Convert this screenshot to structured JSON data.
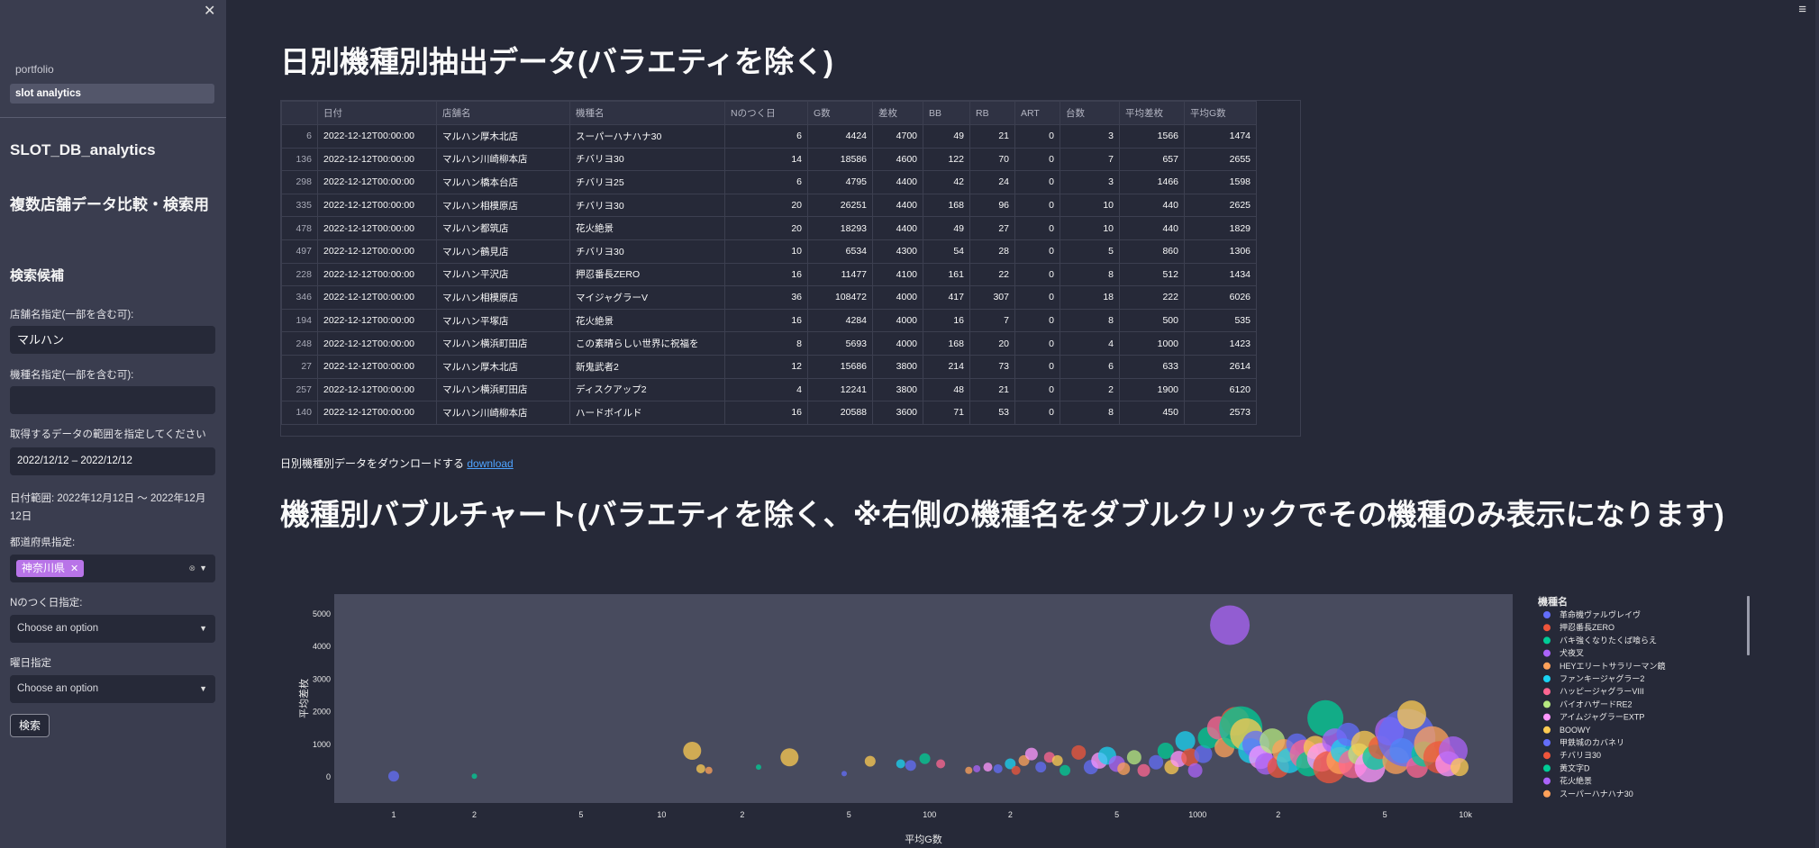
{
  "sidebar": {
    "nav": [
      "portfolio",
      "slot analytics"
    ],
    "title": "SLOT_DB_analytics",
    "subtitle": "複数店舗データ比較・検索用",
    "candidates": "検索候補",
    "store_label": "店舗名指定(一部を含む可):",
    "store_value": "マルハン",
    "machine_label": "機種名指定(一部を含む可):",
    "machine_value": "",
    "range_label": "取得するデータの範囲を指定してください",
    "range_value": "2022/12/12 – 2022/12/12",
    "date_range_text": "日付範囲: 2022年12月12日 ～ 2022年12月12日",
    "pref_label": "都道府県指定:",
    "pref_tag": "神奈川県",
    "n_label": "Nのつく日指定:",
    "n_placeholder": "Choose an option",
    "dow_label": "曜日指定",
    "dow_placeholder": "Choose an option",
    "search_button": "検索"
  },
  "main": {
    "title": "日別機種別抽出データ(バラエティを除く)",
    "download_text": "日別機種別データをダウンロードする",
    "download_link": "download",
    "bubble_title": "機種別バブルチャート(バラエティを除く、※右側の機種名をダブルクリックでその機種のみ表示になります)"
  },
  "table": {
    "columns": [
      "",
      "日付",
      "店舗名",
      "機種名",
      "Nのつく日",
      "G数",
      "差枚",
      "BB",
      "RB",
      "ART",
      "台数",
      "平均差枚",
      "平均G数"
    ],
    "rows": [
      [
        "6",
        "2022-12-12T00:00:00",
        "マルハン厚木北店",
        "スーパーハナハナ30",
        "6",
        "4424",
        "4700",
        "49",
        "21",
        "0",
        "3",
        "1566",
        "1474"
      ],
      [
        "136",
        "2022-12-12T00:00:00",
        "マルハン川崎柳本店",
        "チバリヨ30",
        "14",
        "18586",
        "4600",
        "122",
        "70",
        "0",
        "7",
        "657",
        "2655"
      ],
      [
        "298",
        "2022-12-12T00:00:00",
        "マルハン橋本台店",
        "チバリヨ25",
        "6",
        "4795",
        "4400",
        "42",
        "24",
        "0",
        "3",
        "1466",
        "1598"
      ],
      [
        "335",
        "2022-12-12T00:00:00",
        "マルハン相模原店",
        "チバリヨ30",
        "20",
        "26251",
        "4400",
        "168",
        "96",
        "0",
        "10",
        "440",
        "2625"
      ],
      [
        "478",
        "2022-12-12T00:00:00",
        "マルハン都筑店",
        "花火絶景",
        "20",
        "18293",
        "4400",
        "49",
        "27",
        "0",
        "10",
        "440",
        "1829"
      ],
      [
        "497",
        "2022-12-12T00:00:00",
        "マルハン鶴見店",
        "チバリヨ30",
        "10",
        "6534",
        "4300",
        "54",
        "28",
        "0",
        "5",
        "860",
        "1306"
      ],
      [
        "228",
        "2022-12-12T00:00:00",
        "マルハン平沢店",
        "押忍番長ZERO",
        "16",
        "11477",
        "4100",
        "161",
        "22",
        "0",
        "8",
        "512",
        "1434"
      ],
      [
        "346",
        "2022-12-12T00:00:00",
        "マルハン相模原店",
        "マイジャグラーV",
        "36",
        "108472",
        "4000",
        "417",
        "307",
        "0",
        "18",
        "222",
        "6026"
      ],
      [
        "194",
        "2022-12-12T00:00:00",
        "マルハン平塚店",
        "花火絶景",
        "16",
        "4284",
        "4000",
        "16",
        "7",
        "0",
        "8",
        "500",
        "535"
      ],
      [
        "248",
        "2022-12-12T00:00:00",
        "マルハン横浜町田店",
        "この素晴らしい世界に祝福を",
        "8",
        "5693",
        "4000",
        "168",
        "20",
        "0",
        "4",
        "1000",
        "1423"
      ],
      [
        "27",
        "2022-12-12T00:00:00",
        "マルハン厚木北店",
        "新鬼武者2",
        "12",
        "15686",
        "3800",
        "214",
        "73",
        "0",
        "6",
        "633",
        "2614"
      ],
      [
        "257",
        "2022-12-12T00:00:00",
        "マルハン横浜町田店",
        "ディスクアップ2",
        "4",
        "12241",
        "3800",
        "48",
        "21",
        "0",
        "2",
        "1900",
        "6120"
      ],
      [
        "140",
        "2022-12-12T00:00:00",
        "マルハン川崎柳本店",
        "ハードボイルド",
        "16",
        "20588",
        "3600",
        "71",
        "53",
        "0",
        "8",
        "450",
        "2573"
      ]
    ]
  },
  "chart_data": {
    "type": "scatter",
    "xlabel": "平均G数",
    "ylabel": "平均差枚",
    "x_scale": "log",
    "xlim": [
      0.6,
      15000
    ],
    "ylim": [
      -800,
      5600
    ],
    "x_ticks": [
      "1",
      "2",
      "5",
      "10",
      "2",
      "5",
      "100",
      "2",
      "5",
      "1000",
      "2",
      "5",
      "10k"
    ],
    "y_ticks": [
      "0",
      "1000",
      "2000",
      "3000",
      "4000",
      "5000"
    ],
    "legend_title": "機種名",
    "legend": [
      {
        "name": "革命機ヴァルヴレイヴ",
        "color": "#636efa"
      },
      {
        "name": "押忍番長ZERO",
        "color": "#ef553b"
      },
      {
        "name": "バキ強くなりたくば喰らえ",
        "color": "#00cc96"
      },
      {
        "name": "犬夜叉",
        "color": "#ab63fa"
      },
      {
        "name": "HEYエリートサラリーマン鏡",
        "color": "#ffa15a"
      },
      {
        "name": "ファンキージャグラー2",
        "color": "#19d3f3"
      },
      {
        "name": "ハッピージャグラーVIII",
        "color": "#ff6692"
      },
      {
        "name": "バイオハザードRE2",
        "color": "#b6e880"
      },
      {
        "name": "アイムジャグラーEXTP",
        "color": "#ff97ff"
      },
      {
        "name": "BOOWY",
        "color": "#fecb52"
      },
      {
        "name": "甲鉄城のカバネリ",
        "color": "#636efa"
      },
      {
        "name": "チバリヨ30",
        "color": "#ef553b"
      },
      {
        "name": "黄文字D",
        "color": "#00cc96"
      },
      {
        "name": "花火絶景",
        "color": "#ab63fa"
      },
      {
        "name": "スーパーハナハナ30",
        "color": "#ffa15a"
      }
    ],
    "points": [
      [
        1,
        20,
        6,
        "#636efa"
      ],
      [
        2,
        20,
        3,
        "#00cc96"
      ],
      [
        13,
        800,
        10,
        "#fecb52"
      ],
      [
        14,
        250,
        5,
        "#fecb52"
      ],
      [
        15,
        200,
        4,
        "#ffa15a"
      ],
      [
        23,
        300,
        3,
        "#00cc96"
      ],
      [
        30,
        600,
        10,
        "#fecb52"
      ],
      [
        48,
        100,
        3,
        "#636efa"
      ],
      [
        60,
        480,
        6,
        "#fecb52"
      ],
      [
        78,
        400,
        5,
        "#19d3f3"
      ],
      [
        85,
        350,
        6,
        "#636efa"
      ],
      [
        96,
        560,
        6,
        "#00cc96"
      ],
      [
        110,
        400,
        5,
        "#ff6692"
      ],
      [
        140,
        200,
        4,
        "#ffa15a"
      ],
      [
        150,
        250,
        4,
        "#ab63fa"
      ],
      [
        165,
        300,
        5,
        "#ff97ff"
      ],
      [
        180,
        250,
        5,
        "#636efa"
      ],
      [
        200,
        400,
        6,
        "#19d3f3"
      ],
      [
        210,
        200,
        5,
        "#ef553b"
      ],
      [
        225,
        500,
        6,
        "#ffa15a"
      ],
      [
        240,
        700,
        7,
        "#ff97ff"
      ],
      [
        260,
        300,
        6,
        "#636efa"
      ],
      [
        280,
        600,
        6,
        "#ff6692"
      ],
      [
        300,
        500,
        6,
        "#fecb52"
      ],
      [
        320,
        200,
        6,
        "#00cc96"
      ],
      [
        360,
        750,
        8,
        "#ef553b"
      ],
      [
        400,
        300,
        8,
        "#636efa"
      ],
      [
        430,
        500,
        9,
        "#ff97ff"
      ],
      [
        460,
        650,
        10,
        "#19d3f3"
      ],
      [
        500,
        400,
        9,
        "#ab63fa"
      ],
      [
        530,
        250,
        7,
        "#ffa15a"
      ],
      [
        580,
        600,
        8,
        "#b6e880"
      ],
      [
        630,
        200,
        7,
        "#ff6692"
      ],
      [
        700,
        450,
        8,
        "#636efa"
      ],
      [
        760,
        800,
        9,
        "#00cc96"
      ],
      [
        800,
        300,
        8,
        "#fecb52"
      ],
      [
        850,
        550,
        9,
        "#ff97ff"
      ],
      [
        900,
        1100,
        11,
        "#19d3f3"
      ],
      [
        940,
        600,
        10,
        "#ef553b"
      ],
      [
        980,
        200,
        8,
        "#ab63fa"
      ],
      [
        1050,
        700,
        10,
        "#636efa"
      ],
      [
        1100,
        1200,
        12,
        "#00cc96"
      ],
      [
        1200,
        1500,
        13,
        "#ff6692"
      ],
      [
        1260,
        900,
        11,
        "#ffa15a"
      ],
      [
        1320,
        4650,
        22,
        "#ab63fa"
      ],
      [
        1380,
        1700,
        16,
        "#ef553b"
      ],
      [
        1450,
        1500,
        24,
        "#00cc96"
      ],
      [
        1520,
        1300,
        18,
        "#fecb52"
      ],
      [
        1580,
        800,
        14,
        "#19d3f3"
      ],
      [
        1650,
        1000,
        15,
        "#636efa"
      ],
      [
        1720,
        600,
        13,
        "#ff97ff"
      ],
      [
        1800,
        400,
        12,
        "#ab63fa"
      ],
      [
        1900,
        1100,
        14,
        "#b6e880"
      ],
      [
        2000,
        300,
        12,
        "#ef553b"
      ],
      [
        2100,
        800,
        13,
        "#ffa15a"
      ],
      [
        2200,
        500,
        14,
        "#19d3f3"
      ],
      [
        2350,
        1000,
        12,
        "#636efa"
      ],
      [
        2500,
        700,
        16,
        "#ff6692"
      ],
      [
        2600,
        400,
        14,
        "#00cc96"
      ],
      [
        2750,
        900,
        13,
        "#fecb52"
      ],
      [
        2900,
        600,
        16,
        "#ff97ff"
      ],
      [
        3000,
        1800,
        20,
        "#00cc96"
      ],
      [
        3100,
        300,
        18,
        "#ef553b"
      ],
      [
        3250,
        1100,
        14,
        "#ab63fa"
      ],
      [
        3400,
        500,
        15,
        "#ffa15a"
      ],
      [
        3500,
        800,
        14,
        "#19d3f3"
      ],
      [
        3650,
        1300,
        13,
        "#636efa"
      ],
      [
        3800,
        400,
        16,
        "#ff6692"
      ],
      [
        4000,
        700,
        12,
        "#b6e880"
      ],
      [
        4200,
        1000,
        15,
        "#fecb52"
      ],
      [
        4400,
        300,
        17,
        "#ff97ff"
      ],
      [
        4600,
        600,
        14,
        "#00cc96"
      ],
      [
        4800,
        900,
        13,
        "#ef553b"
      ],
      [
        5200,
        1400,
        16,
        "#ab63fa"
      ],
      [
        5500,
        500,
        15,
        "#ffa15a"
      ],
      [
        5800,
        800,
        14,
        "#19d3f3"
      ],
      [
        6026,
        1200,
        32,
        "#636efa"
      ],
      [
        6300,
        1900,
        16,
        "#fecb52"
      ],
      [
        6600,
        300,
        12,
        "#ff6692"
      ],
      [
        7000,
        700,
        14,
        "#00cc96"
      ],
      [
        7500,
        1000,
        20,
        "#ffa15a"
      ],
      [
        8000,
        600,
        18,
        "#ef553b"
      ],
      [
        8600,
        400,
        14,
        "#ff97ff"
      ],
      [
        9000,
        800,
        16,
        "#ab63fa"
      ],
      [
        9500,
        300,
        10,
        "#fecb52"
      ]
    ]
  }
}
